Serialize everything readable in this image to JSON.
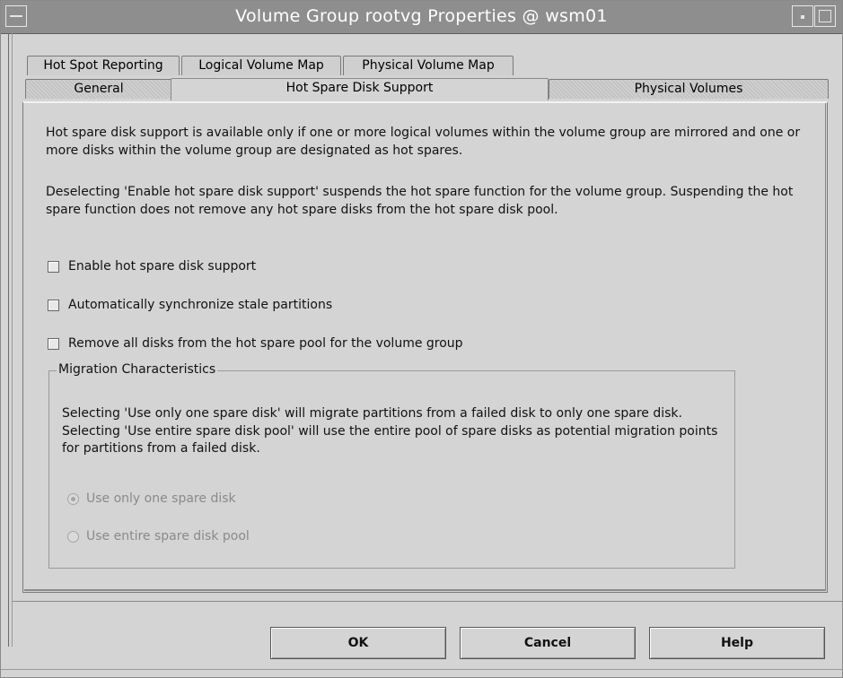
{
  "window": {
    "title": "Volume Group rootvg Properties @ wsm01"
  },
  "tabs": {
    "back_row": [
      "Hot Spot Reporting",
      "Logical Volume Map",
      "Physical Volume Map"
    ],
    "front_row": [
      "General",
      "Hot Spare Disk Support",
      "Physical Volumes"
    ],
    "active": "Hot Spare Disk Support"
  },
  "panel": {
    "intro": "Hot spare disk support is available only if one or more logical volumes within the volume group are mirrored and one or more disks within the volume group are designated as hot spares.",
    "deselect_note": "Deselecting 'Enable hot spare disk support' suspends the hot spare function for the volume group. Suspending the hot spare function does not remove any hot spare disks from the hot spare disk pool.",
    "checkboxes": [
      {
        "label": "Enable hot spare disk support",
        "checked": false
      },
      {
        "label": "Automatically synchronize stale partitions",
        "checked": false
      },
      {
        "label": "Remove all disks from the hot spare pool for the volume group",
        "checked": false
      }
    ],
    "migration": {
      "title": "Migration Characteristics",
      "description": "Selecting 'Use only one spare disk' will migrate partitions from a failed disk to only one spare disk. Selecting 'Use entire spare disk pool' will use the entire pool of spare disks as potential migration points for partitions from a failed disk.",
      "options": [
        {
          "label": "Use only one spare disk",
          "selected": true
        },
        {
          "label": "Use entire spare disk pool",
          "selected": false
        }
      ]
    }
  },
  "buttons": {
    "ok": "OK",
    "cancel": "Cancel",
    "help": "Help"
  }
}
